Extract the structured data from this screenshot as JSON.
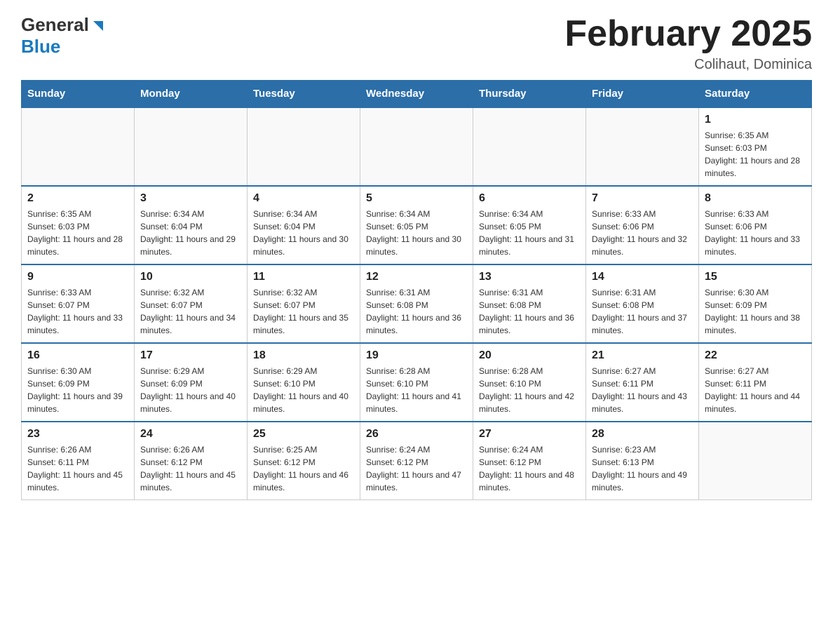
{
  "header": {
    "logo_general": "General",
    "logo_blue": "Blue",
    "month_title": "February 2025",
    "location": "Colihaut, Dominica"
  },
  "days_of_week": [
    "Sunday",
    "Monday",
    "Tuesday",
    "Wednesday",
    "Thursday",
    "Friday",
    "Saturday"
  ],
  "weeks": [
    [
      {
        "day": "",
        "info": ""
      },
      {
        "day": "",
        "info": ""
      },
      {
        "day": "",
        "info": ""
      },
      {
        "day": "",
        "info": ""
      },
      {
        "day": "",
        "info": ""
      },
      {
        "day": "",
        "info": ""
      },
      {
        "day": "1",
        "info": "Sunrise: 6:35 AM\nSunset: 6:03 PM\nDaylight: 11 hours and 28 minutes."
      }
    ],
    [
      {
        "day": "2",
        "info": "Sunrise: 6:35 AM\nSunset: 6:03 PM\nDaylight: 11 hours and 28 minutes."
      },
      {
        "day": "3",
        "info": "Sunrise: 6:34 AM\nSunset: 6:04 PM\nDaylight: 11 hours and 29 minutes."
      },
      {
        "day": "4",
        "info": "Sunrise: 6:34 AM\nSunset: 6:04 PM\nDaylight: 11 hours and 30 minutes."
      },
      {
        "day": "5",
        "info": "Sunrise: 6:34 AM\nSunset: 6:05 PM\nDaylight: 11 hours and 30 minutes."
      },
      {
        "day": "6",
        "info": "Sunrise: 6:34 AM\nSunset: 6:05 PM\nDaylight: 11 hours and 31 minutes."
      },
      {
        "day": "7",
        "info": "Sunrise: 6:33 AM\nSunset: 6:06 PM\nDaylight: 11 hours and 32 minutes."
      },
      {
        "day": "8",
        "info": "Sunrise: 6:33 AM\nSunset: 6:06 PM\nDaylight: 11 hours and 33 minutes."
      }
    ],
    [
      {
        "day": "9",
        "info": "Sunrise: 6:33 AM\nSunset: 6:07 PM\nDaylight: 11 hours and 33 minutes."
      },
      {
        "day": "10",
        "info": "Sunrise: 6:32 AM\nSunset: 6:07 PM\nDaylight: 11 hours and 34 minutes."
      },
      {
        "day": "11",
        "info": "Sunrise: 6:32 AM\nSunset: 6:07 PM\nDaylight: 11 hours and 35 minutes."
      },
      {
        "day": "12",
        "info": "Sunrise: 6:31 AM\nSunset: 6:08 PM\nDaylight: 11 hours and 36 minutes."
      },
      {
        "day": "13",
        "info": "Sunrise: 6:31 AM\nSunset: 6:08 PM\nDaylight: 11 hours and 36 minutes."
      },
      {
        "day": "14",
        "info": "Sunrise: 6:31 AM\nSunset: 6:08 PM\nDaylight: 11 hours and 37 minutes."
      },
      {
        "day": "15",
        "info": "Sunrise: 6:30 AM\nSunset: 6:09 PM\nDaylight: 11 hours and 38 minutes."
      }
    ],
    [
      {
        "day": "16",
        "info": "Sunrise: 6:30 AM\nSunset: 6:09 PM\nDaylight: 11 hours and 39 minutes."
      },
      {
        "day": "17",
        "info": "Sunrise: 6:29 AM\nSunset: 6:09 PM\nDaylight: 11 hours and 40 minutes."
      },
      {
        "day": "18",
        "info": "Sunrise: 6:29 AM\nSunset: 6:10 PM\nDaylight: 11 hours and 40 minutes."
      },
      {
        "day": "19",
        "info": "Sunrise: 6:28 AM\nSunset: 6:10 PM\nDaylight: 11 hours and 41 minutes."
      },
      {
        "day": "20",
        "info": "Sunrise: 6:28 AM\nSunset: 6:10 PM\nDaylight: 11 hours and 42 minutes."
      },
      {
        "day": "21",
        "info": "Sunrise: 6:27 AM\nSunset: 6:11 PM\nDaylight: 11 hours and 43 minutes."
      },
      {
        "day": "22",
        "info": "Sunrise: 6:27 AM\nSunset: 6:11 PM\nDaylight: 11 hours and 44 minutes."
      }
    ],
    [
      {
        "day": "23",
        "info": "Sunrise: 6:26 AM\nSunset: 6:11 PM\nDaylight: 11 hours and 45 minutes."
      },
      {
        "day": "24",
        "info": "Sunrise: 6:26 AM\nSunset: 6:12 PM\nDaylight: 11 hours and 45 minutes."
      },
      {
        "day": "25",
        "info": "Sunrise: 6:25 AM\nSunset: 6:12 PM\nDaylight: 11 hours and 46 minutes."
      },
      {
        "day": "26",
        "info": "Sunrise: 6:24 AM\nSunset: 6:12 PM\nDaylight: 11 hours and 47 minutes."
      },
      {
        "day": "27",
        "info": "Sunrise: 6:24 AM\nSunset: 6:12 PM\nDaylight: 11 hours and 48 minutes."
      },
      {
        "day": "28",
        "info": "Sunrise: 6:23 AM\nSunset: 6:13 PM\nDaylight: 11 hours and 49 minutes."
      },
      {
        "day": "",
        "info": ""
      }
    ]
  ]
}
